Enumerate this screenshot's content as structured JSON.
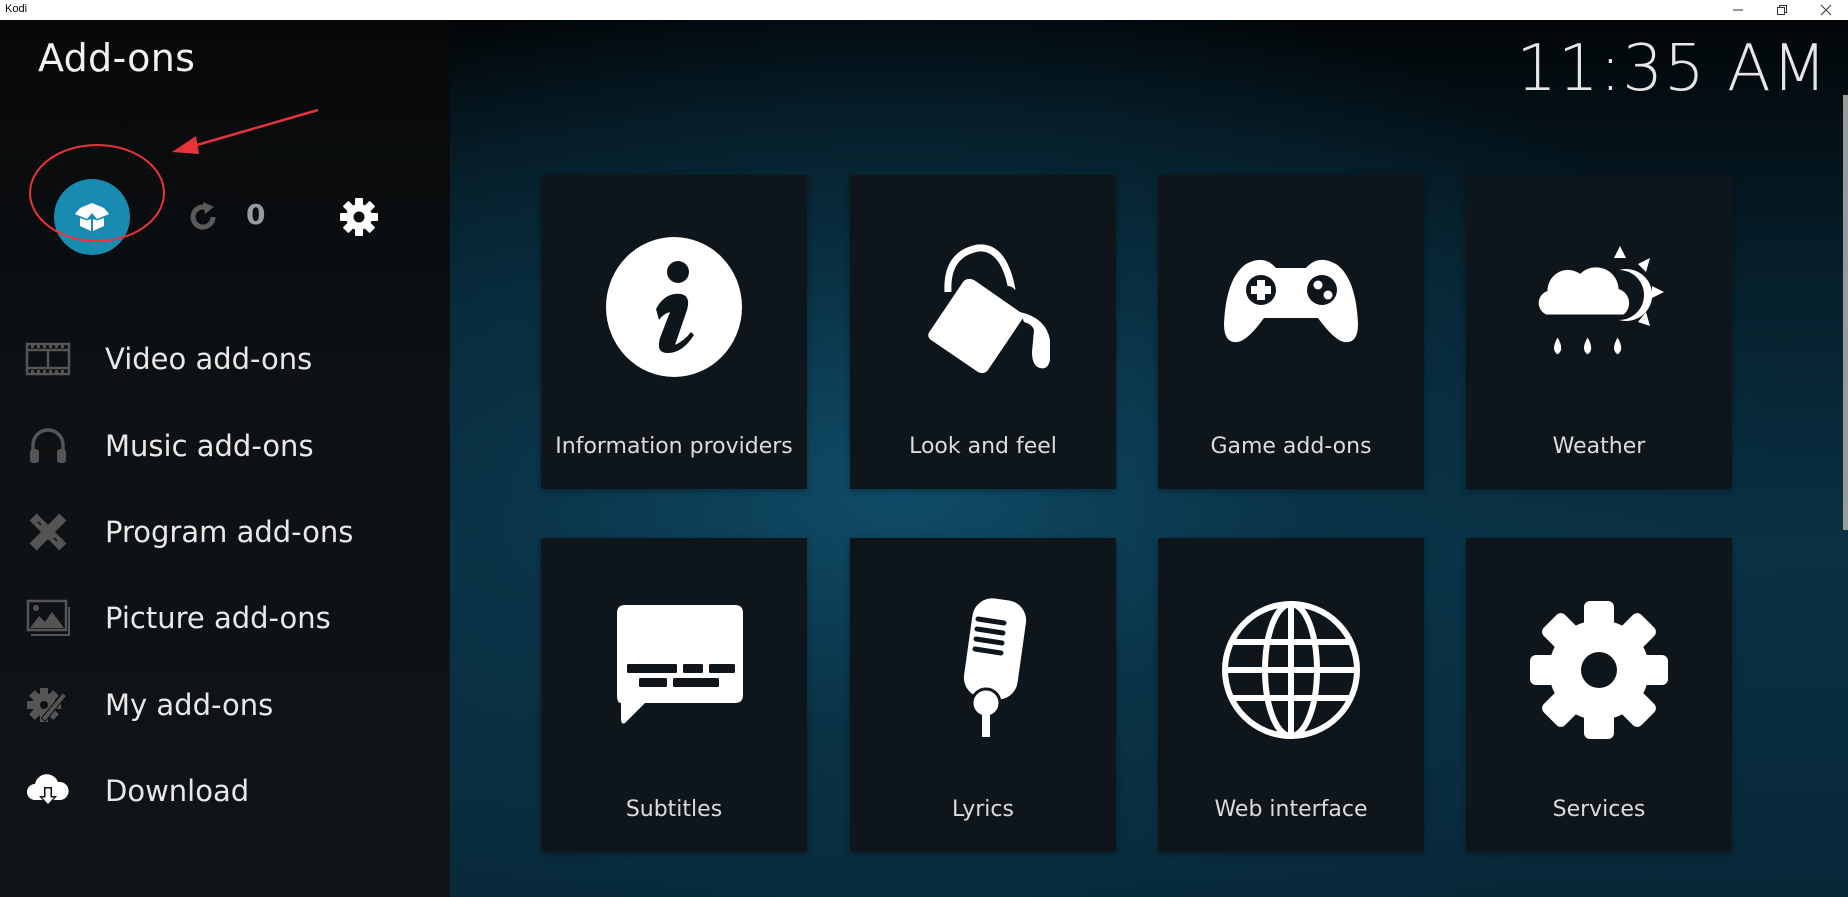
{
  "window": {
    "title": "Kodi",
    "controls": [
      "minimize",
      "restore",
      "close"
    ]
  },
  "header": {
    "title": "Add-ons",
    "clock": "11:35 AM"
  },
  "top_actions": {
    "package_button_icon": "open-box-icon",
    "refresh_icon": "refresh-icon",
    "update_count": "0",
    "settings_icon": "gear-icon"
  },
  "annotation": {
    "highlight": "red-ellipse-around-package-button",
    "arrow": "red-arrow-pointing-to-package-button",
    "color": "#e8333a"
  },
  "sidebar": {
    "items": [
      {
        "label": "Video add-ons",
        "icon": "film-strip-icon"
      },
      {
        "label": "Music add-ons",
        "icon": "headphones-icon"
      },
      {
        "label": "Program add-ons",
        "icon": "pencil-ruler-icon"
      },
      {
        "label": "Picture add-ons",
        "icon": "picture-icon"
      },
      {
        "label": "My add-ons",
        "icon": "gear-tools-icon"
      },
      {
        "label": "Download",
        "icon": "cloud-download-icon"
      }
    ]
  },
  "tiles": [
    {
      "label": "Information providers",
      "icon": "info-icon"
    },
    {
      "label": "Look and feel",
      "icon": "paint-bucket-icon"
    },
    {
      "label": "Game add-ons",
      "icon": "gamepad-icon"
    },
    {
      "label": "Weather",
      "icon": "weather-icon"
    },
    {
      "label": "Subtitles",
      "icon": "subtitles-icon"
    },
    {
      "label": "Lyrics",
      "icon": "microphone-icon"
    },
    {
      "label": "Web interface",
      "icon": "globe-icon"
    },
    {
      "label": "Services",
      "icon": "gear-icon"
    }
  ],
  "colors": {
    "accent": "#1a8bb0",
    "tile_bg": "#0f161b",
    "sidebar_bg": "#0d1114",
    "background_teal": "#0a3144"
  }
}
